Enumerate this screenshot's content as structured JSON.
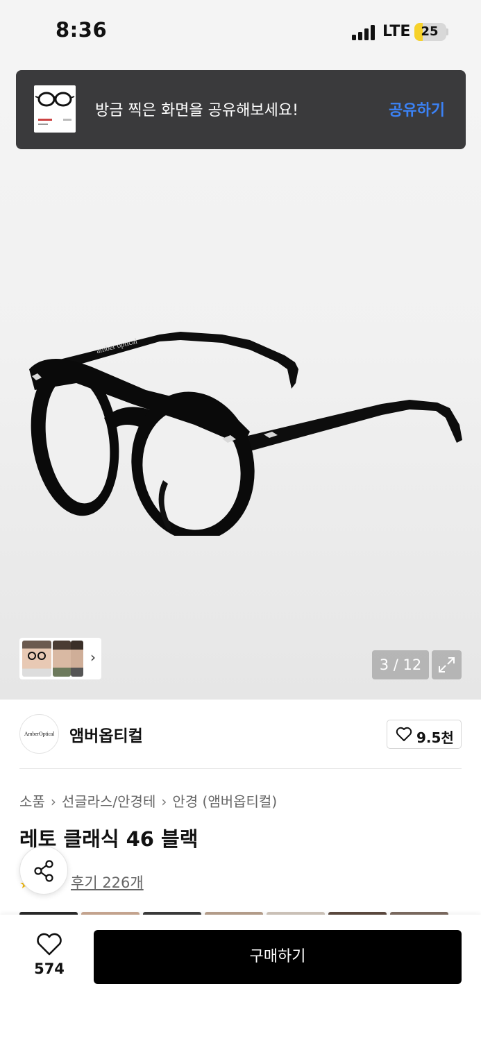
{
  "status_bar": {
    "time": "8:36",
    "network": "LTE",
    "battery": "25",
    "battery_level": 0.25
  },
  "toast": {
    "message": "방금 찍은 화면을 공유해보세요!",
    "action": "공유하기"
  },
  "hero": {
    "image_counter": "3 / 12",
    "frame_brand_text": "amber optical"
  },
  "brand": {
    "logo_text": "AmberOptical",
    "name": "앰버옵티컬",
    "likes": "9.5천"
  },
  "breadcrumb": {
    "items": [
      "소품",
      "선글라스/안경테",
      "안경 (앰버옵티컬)"
    ]
  },
  "product": {
    "title": "레토 클래식 46 블랙",
    "review_link": "후기 226개"
  },
  "bottom_bar": {
    "wish_count": "574",
    "buy_label": "구매하기"
  },
  "colors": {
    "accent_link": "#3b82f6",
    "buy_button": "#000000",
    "toast_bg": "#3a3a3c"
  }
}
